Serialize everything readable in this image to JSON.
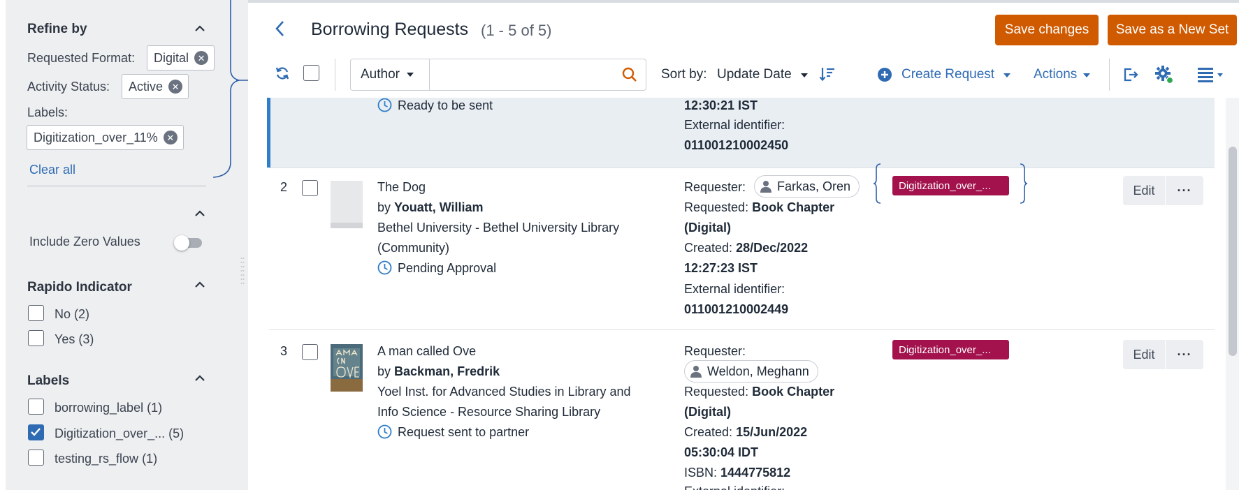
{
  "sidebar": {
    "refine_title": "Refine by",
    "filters": {
      "requested_format_label": "Requested Format:",
      "requested_format_value": "Digital",
      "activity_status_label": "Activity Status:",
      "activity_status_value": "Active",
      "labels_label": "Labels:",
      "labels_value": "Digitization_over_11%",
      "clear_all": "Clear all"
    },
    "include_zero_values": "Include Zero Values",
    "rapido": {
      "title": "Rapido Indicator",
      "options": [
        {
          "label": "No",
          "count": "(2)",
          "checked": false
        },
        {
          "label": "Yes",
          "count": "(3)",
          "checked": false
        }
      ]
    },
    "labels": {
      "title": "Labels",
      "options": [
        {
          "label": "borrowing_label",
          "count": "(1)",
          "checked": false
        },
        {
          "label": "Digitization_over_...",
          "count": "(5)",
          "checked": true
        },
        {
          "label": "testing_rs_flow",
          "count": "(1)",
          "checked": false
        }
      ]
    }
  },
  "header": {
    "title": "Borrowing Requests",
    "count": "(1 - 5 of 5)",
    "save_changes": "Save changes",
    "save_as_new_set": "Save as a New Set"
  },
  "toolbar": {
    "search_field": "Author",
    "search_placeholder": "",
    "sort_label": "Sort by:",
    "sort_value": "Update Date",
    "create_request": "Create Request",
    "actions": "Actions"
  },
  "rows": [
    {
      "status": "Ready to be sent",
      "created_time": "12:30:21 IST",
      "ext_id_label": "External identifier:",
      "ext_id": "011001210002450"
    },
    {
      "number": "2",
      "title": "The Dog",
      "by": "by",
      "author": "Youatt, William",
      "library_line1": "Bethel University - Bethel University Library",
      "library_line2": "(Community)",
      "status": "Pending Approval",
      "requester_label": "Requester:",
      "requester": "Farkas, Oren",
      "requested_label": "Requested:",
      "requested_line1": "Book Chapter",
      "requested_line2": "(Digital)",
      "created_label": "Created:",
      "created_date": "28/Dec/2022",
      "created_time": "12:27:23 IST",
      "ext_id_label": "External identifier:",
      "ext_id": "011001210002449",
      "tag": "Digitization_over_...",
      "edit": "Edit",
      "more": "···"
    },
    {
      "number": "3",
      "title": "A man called Ove",
      "by": "by",
      "author": "Backman, Fredrik",
      "library_line1": "Yoel Inst. for Advanced Studies in Library and",
      "library_line2": "Info Science - Resource Sharing Library",
      "status": "Request sent to partner",
      "requester_label": "Requester:",
      "requester": "Weldon, Meghann",
      "requested_label": "Requested:",
      "requested_line1": "Book Chapter",
      "requested_line2": "(Digital)",
      "created_label": "Created:",
      "created_date": "15/Jun/2022",
      "created_time": "05:30:04 IDT",
      "isbn_label": "ISBN:",
      "isbn": "1444775812",
      "ext_id_partial": "External identifier:",
      "tag": "Digitization_over_...",
      "edit": "Edit",
      "more": "···",
      "cover_text": "A MAN CALLED OVE"
    }
  ],
  "colors": {
    "accent_blue": "#2f6bb3",
    "orange": "#cf5a00",
    "tag": "#a3124d",
    "selected_row": "#e9eef3",
    "sidebar_bg": "#eeeff1"
  },
  "icons": [
    "chevron-up-icon",
    "clear-chip-icon",
    "back-icon",
    "refresh-icon",
    "search-icon",
    "sort-descending-icon",
    "plus-circle-icon",
    "export-icon",
    "settings-gear-icon",
    "list-view-icon",
    "clock-icon",
    "person-icon",
    "check-icon"
  ]
}
